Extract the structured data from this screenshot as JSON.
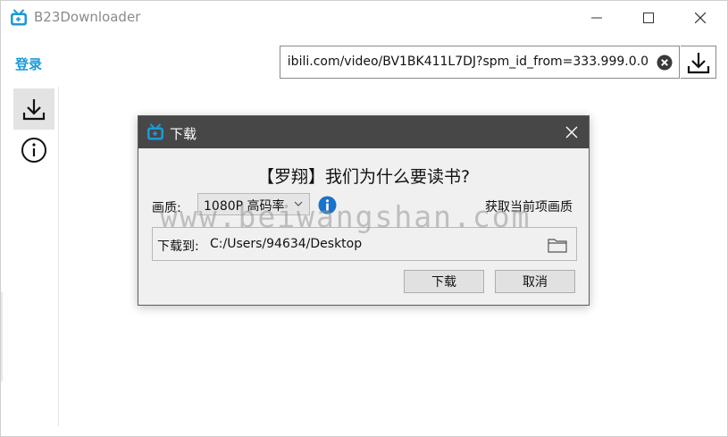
{
  "window": {
    "title": "B23Downloader",
    "icon": "bilibili-tv-icon"
  },
  "header": {
    "login_label": "登录",
    "url_value": "ibili.com/video/BV1BK411L7DJ?spm_id_from=333.999.0.0"
  },
  "sidebar": {
    "items": [
      {
        "icon": "download-icon",
        "active": true
      },
      {
        "icon": "info-icon",
        "active": false
      }
    ]
  },
  "watermark": "www.beiwangshan.com",
  "dialog": {
    "title": "下载",
    "video_title": "【罗翔】我们为什么要读书?",
    "quality_label": "画质:",
    "quality_selected": "1080P 高码率",
    "get_quality_label": "获取当前项画质",
    "save_to_label": "下载到:",
    "save_path": "C:/Users/94634/Desktop",
    "ok_label": "下载",
    "cancel_label": "取消"
  },
  "colors": {
    "accent": "#1b9ad7",
    "dialog_titlebar": "#474747",
    "info_blue": "#1a73c8"
  }
}
